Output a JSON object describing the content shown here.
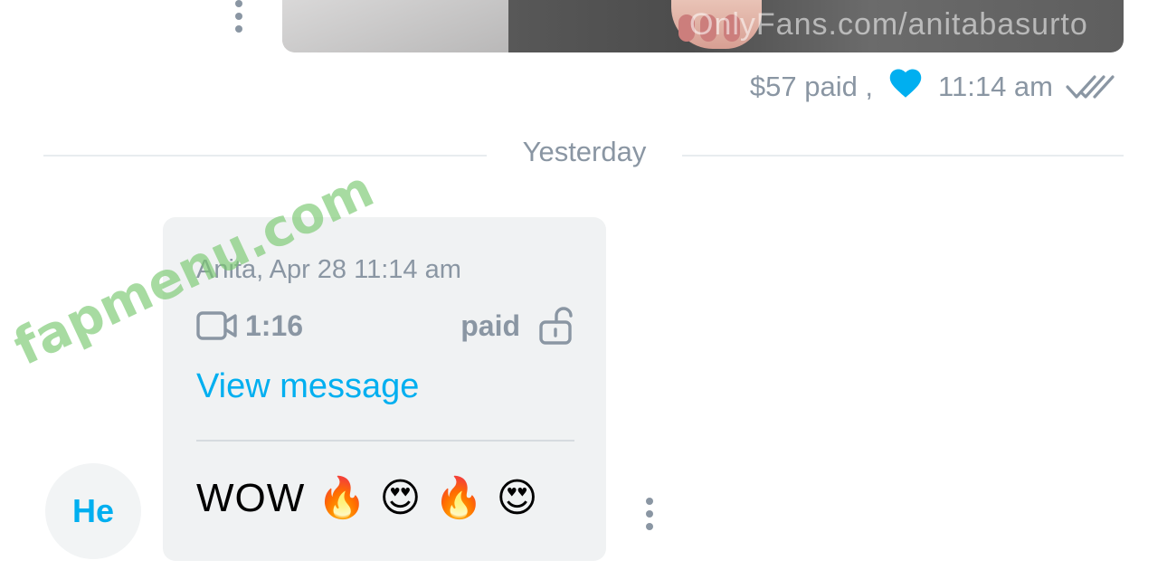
{
  "top_message": {
    "image_watermark": "OnlyFans.com/anitabasurto",
    "price_text": "$57 paid ,",
    "time": "11:14 am",
    "liked": true,
    "heart_color": "#00aff0",
    "read_status": "double-check"
  },
  "date_divider": {
    "label": "Yesterday"
  },
  "incoming_message": {
    "avatar_initials": "He",
    "sender_line": "Anita, Apr 28 11:14 am",
    "media_duration": "1:16",
    "media_type": "video-icon",
    "paid_label": "paid",
    "lock_state": "unlocked",
    "view_link": "View message",
    "text": "WOW 🔥 😍 🔥 😍"
  },
  "overlay_watermark": "fapmenu.com",
  "colors": {
    "accent": "#00aff0",
    "muted_text": "#8a96a3",
    "bubble_bg": "#f0f2f3"
  }
}
